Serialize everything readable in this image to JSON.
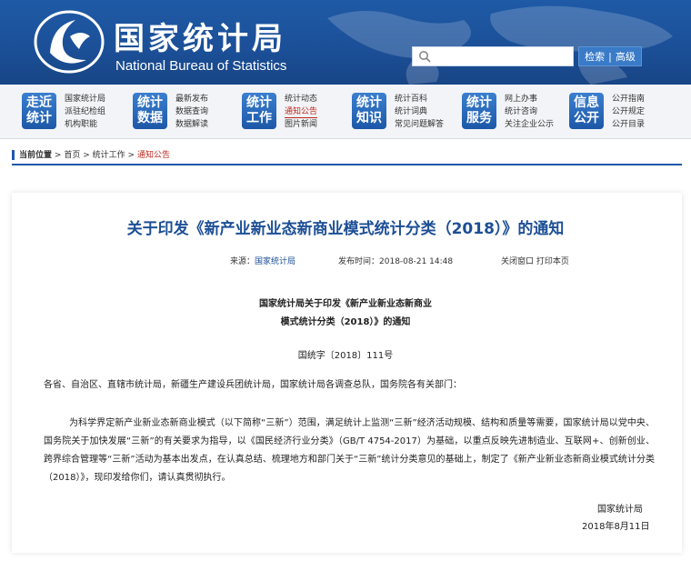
{
  "header": {
    "site_name_cn": "国家统计局",
    "site_name_en": "National Bureau of Statistics",
    "search_placeholder": "",
    "search_button": "检索",
    "advanced_search": "高级"
  },
  "nav": [
    {
      "tile": [
        "走近",
        "统计"
      ],
      "links": [
        "国家统计局",
        "派驻纪检组",
        "机构职能"
      ]
    },
    {
      "tile": [
        "统计",
        "数据"
      ],
      "links": [
        "最新发布",
        "数据查询",
        "数据解读"
      ]
    },
    {
      "tile": [
        "统计",
        "工作"
      ],
      "links": [
        "统计动态",
        "通知公告",
        "图片新闻"
      ]
    },
    {
      "tile": [
        "统计",
        "知识"
      ],
      "links": [
        "统计百科",
        "统计词典",
        "常见问题解答"
      ]
    },
    {
      "tile": [
        "统计",
        "服务"
      ],
      "links": [
        "网上办事",
        "统计咨询",
        "关注企业公示"
      ]
    },
    {
      "tile": [
        "信息",
        "公开"
      ],
      "links": [
        "公开指南",
        "公开规定",
        "公开目录"
      ]
    }
  ],
  "breadcrumb": {
    "label": "当前位置",
    "home": "首页",
    "section": "统计工作",
    "current": "通知公告",
    "sep": ">"
  },
  "article": {
    "title": "关于印发《新产业新业态新商业模式统计分类（2018）》的通知",
    "source_label": "来源：",
    "source": "国家统计局",
    "time_label": "发布时间：",
    "time": "2018-08-21 14:48",
    "close": "关闭窗口",
    "print": "打印本页",
    "doc_title_line1": "国家统计局关于印发《新产业新业态新商业",
    "doc_title_line2": "模式统计分类（2018）》的通知",
    "doc_number": "国统字〔2018〕111号",
    "addressee": "各省、自治区、直辖市统计局，新疆生产建设兵团统计局，国家统计局各调查总队，国务院各有关部门：",
    "body": "为科学界定新产业新业态新商业模式（以下简称“三新”）范围，满足统计上监测“三新”经济活动规模、结构和质量等需要，国家统计局以党中央、国务院关于加快发展“三新”的有关要求为指导，以《国民经济行业分类》（GB/T 4754-2017）为基础，以重点反映先进制造业、互联网+、创新创业、跨界综合管理等“三新”活动为基本出发点，在认真总结、梳理地方和部门关于“三新”统计分类意见的基础上，制定了《新产业新业态新商业模式统计分类（2018）》，现印发给你们，请认真贯彻执行。",
    "signature": "国家统计局",
    "date": "2018年8月11日"
  },
  "colors": {
    "brand_blue": "#1d58a8",
    "title_blue": "#1d4f96",
    "accent_red": "#c0271f"
  }
}
